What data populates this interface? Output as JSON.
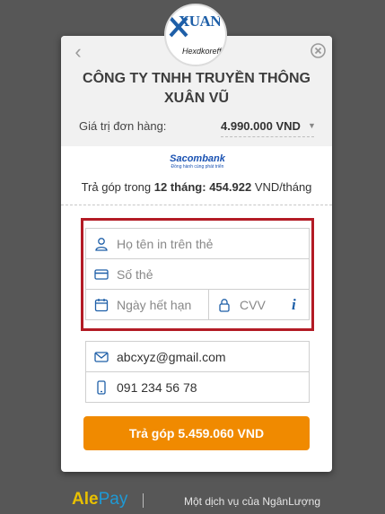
{
  "merchant": {
    "logo_name": "XUANVU",
    "logo_sub": "Hexdkoreff",
    "company_line1": "CÔNG TY TNHH TRUYỀN THÔNG",
    "company_line2": "XUÂN VŨ"
  },
  "order": {
    "label": "Giá trị đơn hàng:",
    "value": "4.990.000 VND"
  },
  "bank": {
    "name": "Sacombank",
    "tagline": "Đồng hành cùng phát triển"
  },
  "installment": {
    "prefix": "Trả góp trong",
    "term": "12 tháng:",
    "amount": "454.922",
    "suffix": "VND/tháng"
  },
  "card_form": {
    "name_placeholder": "Họ tên in trên thẻ",
    "number_placeholder": "Số thẻ",
    "expiry_placeholder": "Ngày hết hạn",
    "cvv_placeholder": "CVV"
  },
  "contact": {
    "email": "abcxyz@gmail.com",
    "phone": "091 234 56 78"
  },
  "pay_button": "Trả góp 5.459.060 VND",
  "footer": {
    "brand_a": "Ale",
    "brand_b": "Pay",
    "provider_text": "Một dịch vụ của NgânLượng"
  },
  "colors": {
    "accent_orange": "#f08a00",
    "highlight_red": "#b31b25",
    "icon_blue": "#1e5fa8"
  }
}
